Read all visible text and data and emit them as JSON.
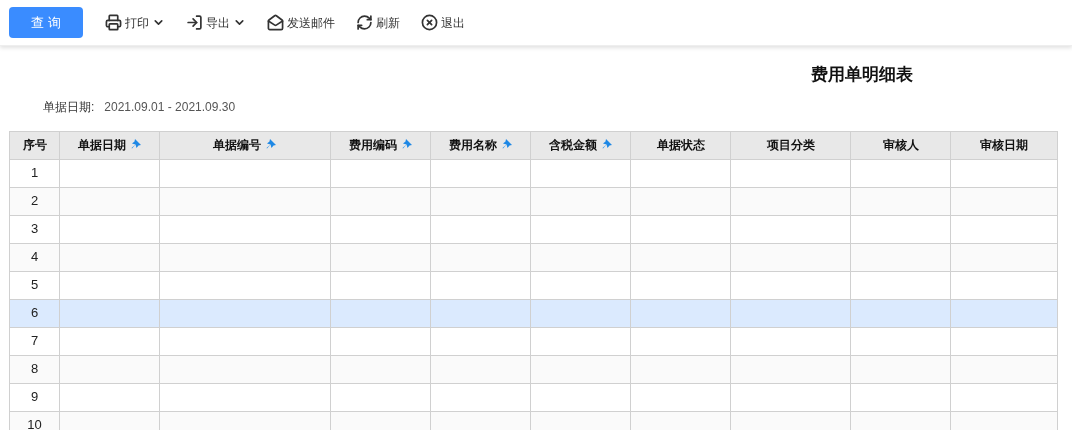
{
  "toolbar": {
    "query_button": "查 询",
    "actions": [
      {
        "label": "打印",
        "dropdown": true
      },
      {
        "label": "导出",
        "dropdown": true
      },
      {
        "label": "发送邮件",
        "dropdown": false
      },
      {
        "label": "刷新",
        "dropdown": false
      },
      {
        "label": "退出",
        "dropdown": false
      }
    ]
  },
  "report": {
    "title": "费用单明细表",
    "filter_label": "单据日期:",
    "filter_value": "2021.09.01 - 2021.09.30"
  },
  "table": {
    "columns": [
      {
        "label": "序号",
        "sortable": false
      },
      {
        "label": "单据日期",
        "sortable": true
      },
      {
        "label": "单据编号",
        "sortable": true
      },
      {
        "label": "费用编码",
        "sortable": true
      },
      {
        "label": "费用名称",
        "sortable": true
      },
      {
        "label": "含税金额",
        "sortable": true
      },
      {
        "label": "单据状态",
        "sortable": false
      },
      {
        "label": "项目分类",
        "sortable": false
      },
      {
        "label": "审核人",
        "sortable": false
      },
      {
        "label": "审核日期",
        "sortable": false
      }
    ],
    "rows": [
      {
        "index": "1",
        "selected": false
      },
      {
        "index": "2",
        "selected": false
      },
      {
        "index": "3",
        "selected": false
      },
      {
        "index": "4",
        "selected": false
      },
      {
        "index": "5",
        "selected": false
      },
      {
        "index": "6",
        "selected": true
      },
      {
        "index": "7",
        "selected": false
      },
      {
        "index": "8",
        "selected": false
      },
      {
        "index": "9",
        "selected": false
      },
      {
        "index": "10",
        "selected": false
      }
    ]
  }
}
